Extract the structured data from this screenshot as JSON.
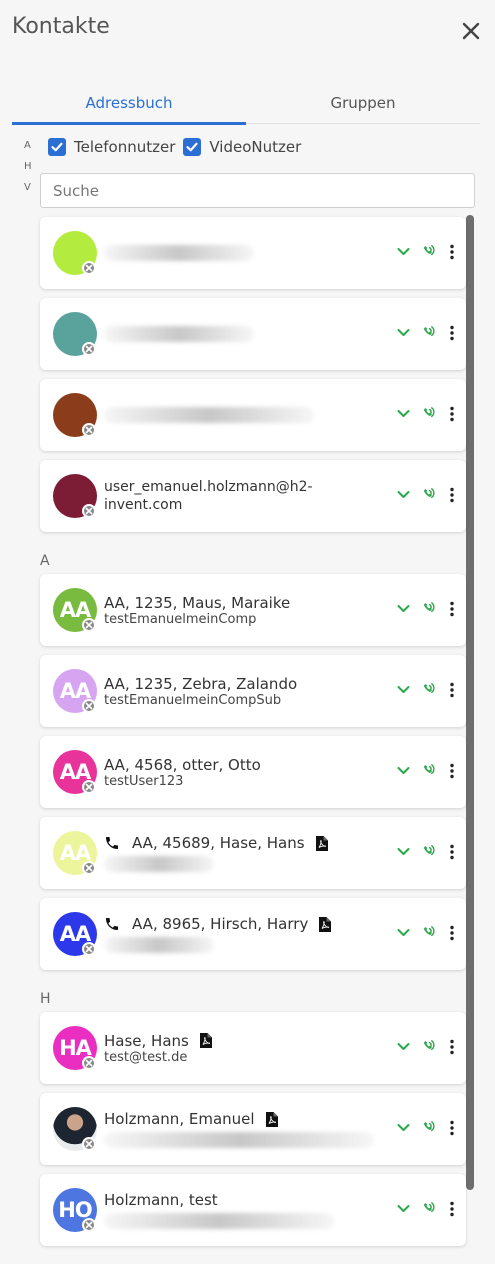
{
  "header": {
    "title": "Kontakte"
  },
  "tabs": [
    {
      "label": "Adressbuch"
    },
    {
      "label": "Gruppen"
    }
  ],
  "alpha_index": [
    "A",
    "H",
    "V"
  ],
  "filters": {
    "telefon_label": "Telefonnutzer",
    "video_label": "VideoNutzer"
  },
  "search": {
    "placeholder": "Suche"
  },
  "colors": {
    "accent": "#2b6fd4",
    "action_green": "#2aa84a"
  },
  "sections": {
    "a": "A",
    "h": "H"
  },
  "contacts": [
    {
      "initials": "",
      "color": "#b3ec3e",
      "name": "",
      "sub": ""
    },
    {
      "initials": "",
      "color": "#5aa39c",
      "name": "",
      "sub": ""
    },
    {
      "initials": "",
      "color": "#8b3c1b",
      "name": "",
      "sub": ""
    },
    {
      "initials": "",
      "color": "#7c1c35",
      "name": "user_emanuel.holzmann@h2-invent.com",
      "sub": ""
    },
    {
      "initials": "AA",
      "color": "#79bb3e",
      "name": "AA, 1235, Maus, Maraike",
      "sub": "testEmanuelmeinComp"
    },
    {
      "initials": "AA",
      "color": "#d7a4f2",
      "name": "AA, 1235, Zebra, Zalando",
      "sub": "testEmanuelmeinCompSub"
    },
    {
      "initials": "AA",
      "color": "#e8339b",
      "name": "AA, 4568, otter, Otto",
      "sub": "testUser123"
    },
    {
      "initials": "AA",
      "color": "#ecf59c",
      "name": "AA, 45689, Hase, Hans",
      "sub": ""
    },
    {
      "initials": "AA",
      "color": "#2c38e9",
      "name": "AA, 8965, Hirsch, Harry",
      "sub": ""
    },
    {
      "initials": "HA",
      "color": "#ea2ec2",
      "name": "Hase, Hans",
      "sub": "test@test.de"
    },
    {
      "initials": "",
      "color": "#dddddd",
      "name": "Holzmann, Emanuel",
      "sub": ""
    },
    {
      "initials": "HO",
      "color": "#4d76e0",
      "name": "Holzmann, test",
      "sub": ""
    }
  ]
}
